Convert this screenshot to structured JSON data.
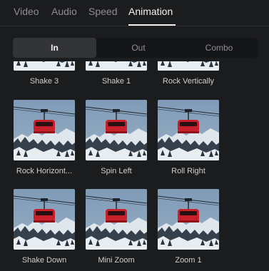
{
  "top_tabs": [
    {
      "label": "Video",
      "active": false
    },
    {
      "label": "Audio",
      "active": false
    },
    {
      "label": "Speed",
      "active": false
    },
    {
      "label": "Animation",
      "active": true
    }
  ],
  "sub_tabs": [
    {
      "label": "In",
      "active": true
    },
    {
      "label": "Out",
      "active": false
    },
    {
      "label": "Combo",
      "active": false
    }
  ],
  "presets": [
    {
      "label": "Shake 3",
      "thumbnail": "gondola-thumbnail"
    },
    {
      "label": "Shake 1",
      "thumbnail": "gondola-thumbnail"
    },
    {
      "label": "Rock Vertically",
      "thumbnail": "gondola-thumbnail"
    },
    {
      "label": "Rock Horizont...",
      "thumbnail": "gondola-thumbnail"
    },
    {
      "label": "Spin Left",
      "thumbnail": "gondola-thumbnail"
    },
    {
      "label": "Roll Right",
      "thumbnail": "gondola-thumbnail"
    },
    {
      "label": "Shake Down",
      "thumbnail": "gondola-thumbnail"
    },
    {
      "label": "Mini Zoom",
      "thumbnail": "gondola-thumbnail"
    },
    {
      "label": "Zoom 1",
      "thumbnail": "gondola-thumbnail"
    }
  ],
  "colors": {
    "background": "#1b1c1e",
    "active_text": "#f2f2f2",
    "inactive_text": "#8d8e91",
    "gondola_red": "#c8202a"
  }
}
